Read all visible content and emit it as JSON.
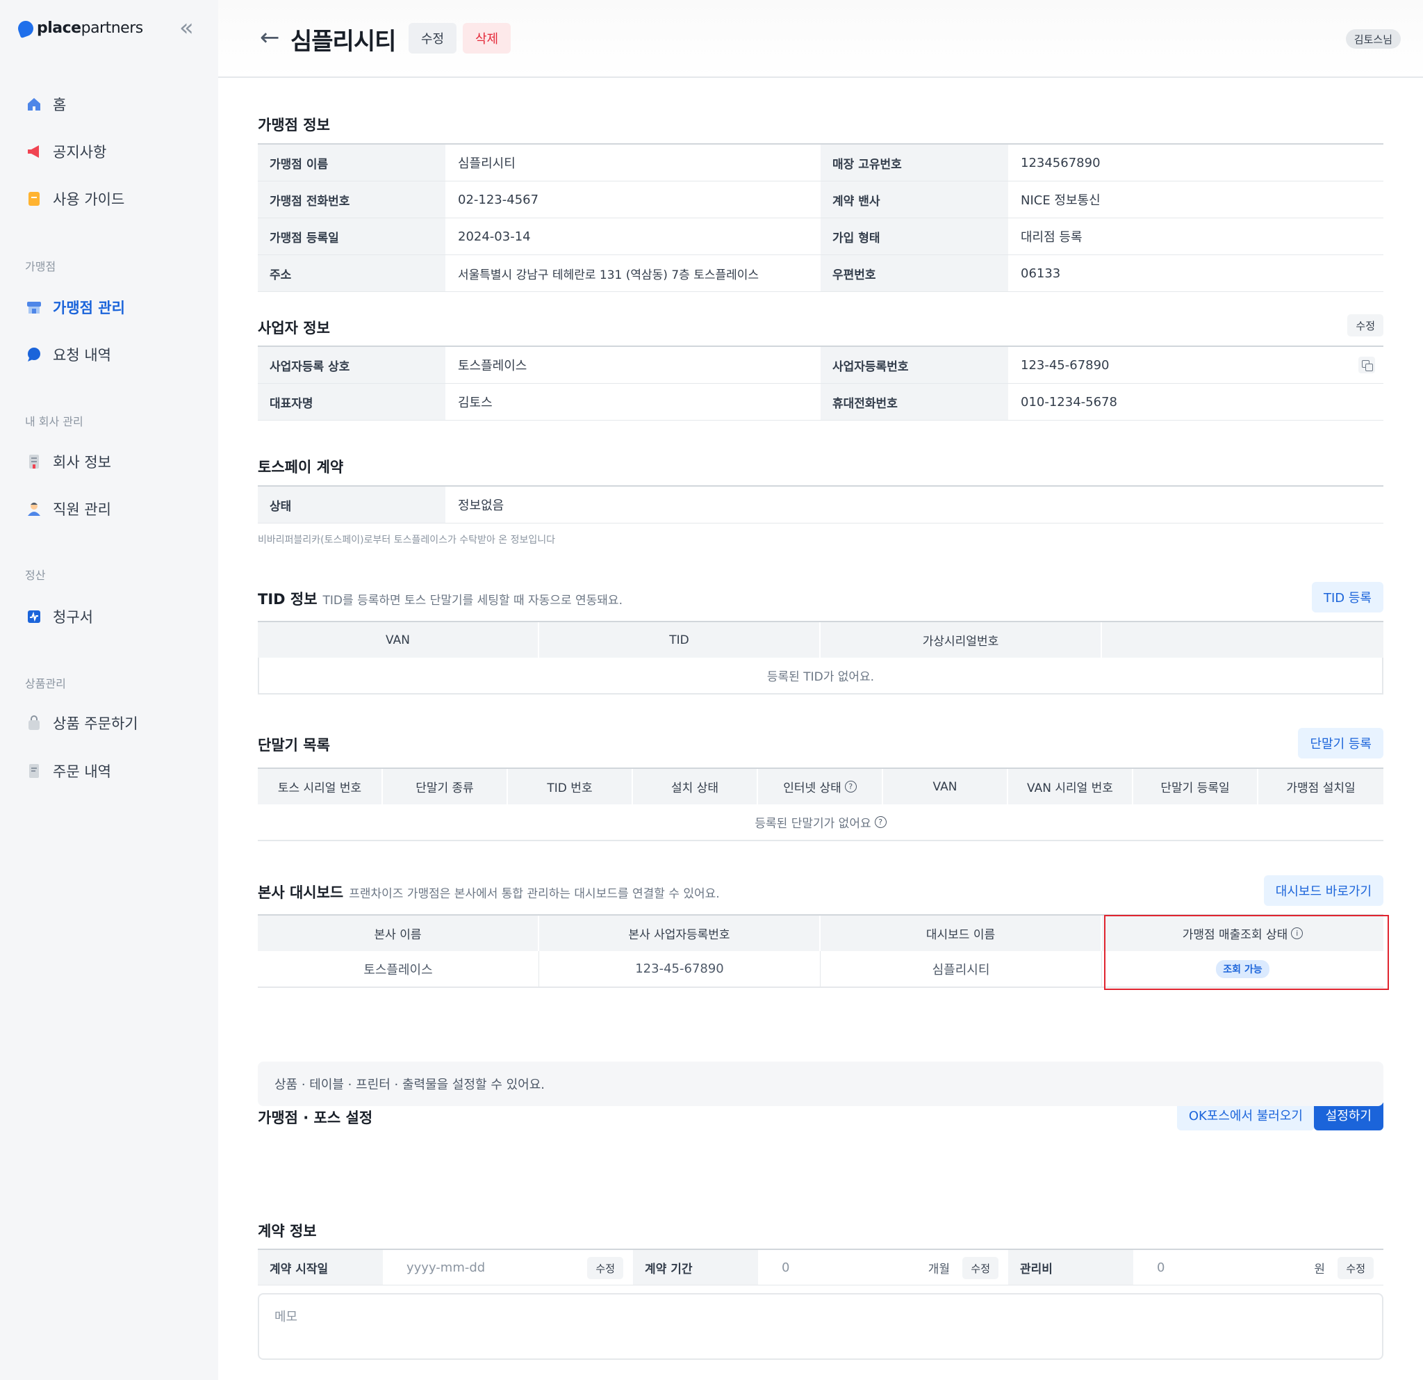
{
  "sidebar": {
    "logo_bold": "place",
    "logo_light": "partners",
    "items": [
      {
        "label": "홈",
        "icon": "home-icon"
      },
      {
        "label": "공지사항",
        "icon": "megaphone-icon"
      },
      {
        "label": "사용 가이드",
        "icon": "guide-icon"
      }
    ],
    "section_store": "가맹점",
    "store_items": [
      {
        "label": "가맹점 관리",
        "icon": "store-icon",
        "active": true
      },
      {
        "label": "요청 내역",
        "icon": "chat-icon"
      }
    ],
    "section_company": "내 회사 관리",
    "company_items": [
      {
        "label": "회사 정보",
        "icon": "building-icon"
      },
      {
        "label": "직원 관리",
        "icon": "person-icon"
      }
    ],
    "section_settle": "정산",
    "settle_items": [
      {
        "label": "청구서",
        "icon": "invoice-icon"
      }
    ],
    "section_product": "상품관리",
    "product_items": [
      {
        "label": "상품 주문하기",
        "icon": "bag-icon"
      },
      {
        "label": "주문 내역",
        "icon": "receipt-icon"
      }
    ]
  },
  "header": {
    "title": "심플리시티",
    "edit_label": "수정",
    "delete_label": "삭제",
    "user": "김토스님"
  },
  "store_info": {
    "title": "가맹점 정보",
    "rows": [
      [
        {
          "k": "가맹점 이름",
          "v": "심플리시티"
        },
        {
          "k": "매장 고유번호",
          "v": "1234567890"
        }
      ],
      [
        {
          "k": "가맹점 전화번호",
          "v": "02-123-4567"
        },
        {
          "k": "계약 밴사",
          "v": "NICE 정보통신"
        }
      ],
      [
        {
          "k": "가맹점 등록일",
          "v": "2024-03-14"
        },
        {
          "k": "가입 형태",
          "v": "대리점 등록"
        }
      ],
      [
        {
          "k": "주소",
          "v": "서울특별시 강남구 테헤란로 131 (역삼동) 7층 토스플레이스"
        },
        {
          "k": "우편번호",
          "v": "06133"
        }
      ]
    ]
  },
  "business_info": {
    "title": "사업자 정보",
    "edit_label": "수정",
    "rows": [
      [
        {
          "k": "사업자등록 상호",
          "v": "토스플레이스"
        },
        {
          "k": "사업자등록번호",
          "v": "123-45-67890"
        }
      ],
      [
        {
          "k": "대표자명",
          "v": "김토스"
        },
        {
          "k": "휴대전화번호",
          "v": "010-1234-5678"
        }
      ]
    ]
  },
  "tosspay": {
    "title": "토스페이 계약",
    "status_key": "상태",
    "status_value": "정보없음",
    "note": "비바리퍼블리카(토스페이)로부터 토스플레이스가 수탁받아 온 정보입니다"
  },
  "tid": {
    "title": "TID 정보",
    "desc": "TID를 등록하면 토스 단말기를 세팅할 때 자동으로 연동돼요.",
    "button": "TID 등록",
    "columns": [
      "VAN",
      "TID",
      "가상시리얼번호",
      ""
    ],
    "empty": "등록된 TID가 없어요."
  },
  "terminals": {
    "title": "단말기 목록",
    "button": "단말기 등록",
    "columns": [
      "토스 시리얼 번호",
      "단말기 종류",
      "TID 번호",
      "설치 상태",
      "인터넷 상태",
      "VAN",
      "VAN 시리얼 번호",
      "단말기 등록일",
      "가맹점 설치일"
    ],
    "help_mark": "?",
    "empty": "등록된 단말기가 없어요"
  },
  "dashboard": {
    "title": "본사 대시보드",
    "desc": "프랜차이즈 가맹점은 본사에서 통합 관리하는 대시보드를 연결할 수 있어요.",
    "button": "대시보드 바로가기",
    "columns": [
      "본사 이름",
      "본사 사업자등록번호",
      "대시보드 이름",
      "가맹점 매출조회 상태"
    ],
    "info_mark": "i",
    "row": [
      "토스플레이스",
      "123-45-67890",
      "심플리시티",
      "조회 가능"
    ]
  },
  "pos_settings": {
    "title": "가맹점 · 포스 설정",
    "import_button": "OK포스에서 불러오기",
    "setup_button": "설정하기",
    "desc": "상품 · 테이블 · 프린터 · 출력물을 설정할 수 있어요."
  },
  "contract": {
    "title": "계약 정보",
    "start_label": "계약 시작일",
    "start_placeholder": "yyyy-mm-dd",
    "period_label": "계약 기간",
    "period_value": "0",
    "period_unit": "개월",
    "fee_label": "관리비",
    "fee_value": "0",
    "fee_unit": "원",
    "edit_label": "수정",
    "memo_placeholder": "메모"
  },
  "colors": {
    "accent": "#1b64da",
    "danger": "#e42939",
    "highlight": "#e0242f"
  }
}
